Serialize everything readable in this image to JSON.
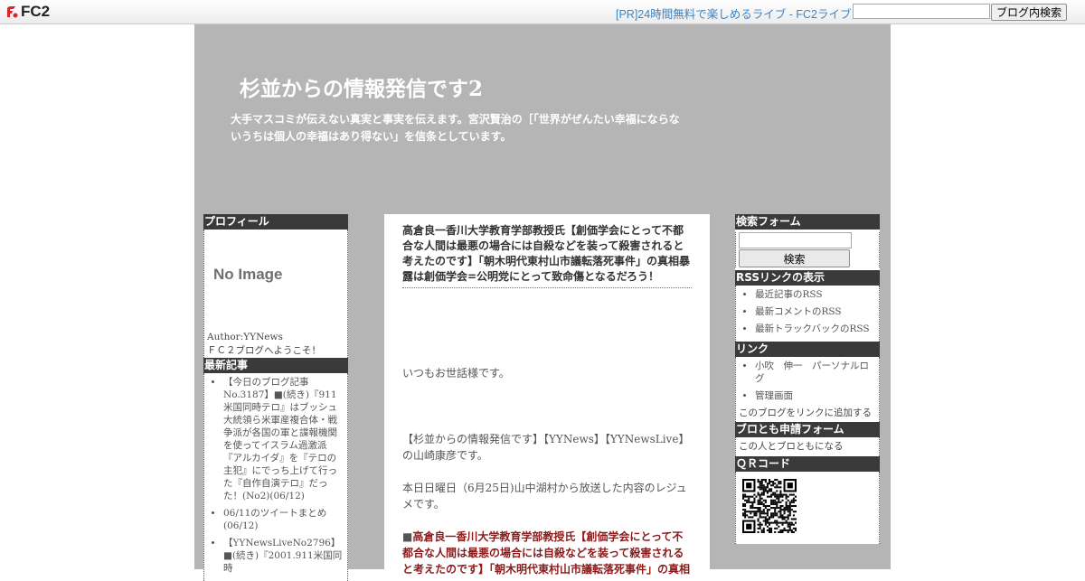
{
  "topbar": {
    "logo_text": "FC2",
    "pr_link": "[PR]24時間無料で楽しめるライブ - FC2ライブ",
    "search_placeholder": "",
    "search_button": "ブログ内検索"
  },
  "blog": {
    "title": "杉並からの情報発信です2",
    "description": "大手マスコミが伝えない真実と事実を伝えます。宮沢賢治の［「世界がぜんたい幸福にならないうちは個人の幸福はあり得ない」を信条としています。"
  },
  "left_sidebar": {
    "profile_heading": "プロフィール",
    "no_image": "No Image",
    "author": "Author:YYNews",
    "welcome": "ＦＣ２ブログへようこそ！",
    "recent_heading": "最新記事",
    "recent_items": [
      {
        "text": "【今日のブログ記事No.3187】■(続き)『911米国同時テロ』はブッシュ大統領ら米軍産複合体・戦争派が各国の軍と諜報機関を使ってイスラム過激派『アルカイダ』を『テロの主犯』にでっち上げて行った『自作自演テロ』だった！(No2)",
        "date": "(06/12)"
      },
      {
        "text": "06/11のツイートまとめ",
        "date": "(06/12)"
      },
      {
        "text": "【YYNewsLiveNo2796】■(続き)『2001.911米国同時",
        "date": ""
      }
    ]
  },
  "right_sidebar": {
    "search_heading": "検索フォーム",
    "search_button": "検索",
    "rss_heading": "RSSリンクの表示",
    "rss_items": [
      "最近記事のRSS",
      "最新コメントのRSS",
      "最新トラックバックのRSS"
    ],
    "links_heading": "リンク",
    "link_items": [
      "小吹　伸一　パーソナルログ",
      "管理画面"
    ],
    "add_link": "このブログをリンクに追加する",
    "friend_heading": "ブロとも申請フォーム",
    "friend_link": "この人とブロともになる",
    "qr_heading": "ＱＲコード"
  },
  "entry": {
    "title": "高倉良一香川大学教育学部教授氏【創価学会にとって不都合な人間は最悪の場合には自殺などを装って殺害されると考えたのです】「朝木明代東村山市議転落死事件」の真相暴露は創価学会=公明党にとって致命傷となるだろう！",
    "greeting": "いつもお世話様です。",
    "intro": "【杉並からの情報発信です】【YYNews】【YYNewsLive】の山崎康彦です。",
    "broadcast": "本日日曜日（6月25日)山中湖村から放送した内容のレジュメです。",
    "bullet": "■",
    "highlight": "高倉良一香川大学教育学部教授氏【創価学会にとって不都合な人間は最悪の場合には自殺などを装って殺害されると考えたのです】「朝木明代東村山市議転落死事件」の真相"
  }
}
